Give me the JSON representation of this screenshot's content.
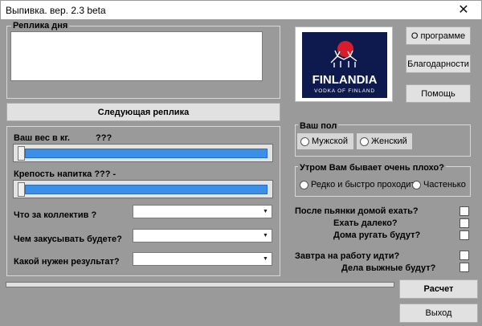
{
  "window": {
    "title": "Выпивка. вер. 2.3 beta",
    "close_glyph": "✕"
  },
  "phrase": {
    "legend": "Реплика дня",
    "text": "",
    "next_button": "Следующая реплика"
  },
  "logo": {
    "brand": "FINLANDIA",
    "tagline": "VODKA OF FINLAND",
    "sun_color": "#d81c2a",
    "bg_color": "#0e1a4d"
  },
  "buttons": {
    "about": "О программе",
    "thanks": "Благодарности",
    "help": "Помощь",
    "calc": "Расчет",
    "exit": "Выход"
  },
  "weight": {
    "label": "Ваш вес в кг.",
    "value": "???",
    "slider_position": 0
  },
  "strength": {
    "label": "Крепость напитка ??? -",
    "slider_position": 0
  },
  "company": {
    "label": "Что за коллектив ?",
    "value": ""
  },
  "snack": {
    "label": "Чем закусывать будете?",
    "value": ""
  },
  "result": {
    "label": "Какой нужен результат?",
    "value": ""
  },
  "gender": {
    "legend": "Ваш пол",
    "male": "Мужской",
    "female": "Женский"
  },
  "morning": {
    "legend": "Утром Вам бывает очень плохо?",
    "rarely": "Редко и быстро проходит",
    "often": "Частенько"
  },
  "questions": {
    "drive_home": "После пьянки домой ехать?",
    "far": "Ехать далеко?",
    "scold": "Дома ругать будут?",
    "work": "Завтра на работу идти?",
    "important": "Дела выжные будут?"
  },
  "progress": {
    "value": 0
  }
}
